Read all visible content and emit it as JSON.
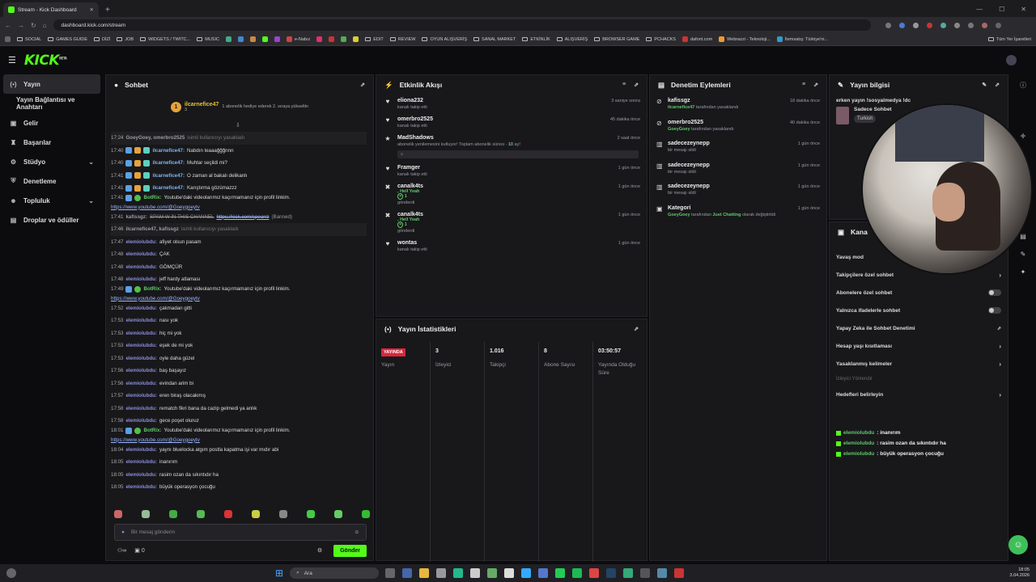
{
  "browser": {
    "tab_title": "Stream - Kick Dashboard",
    "url": "dashboard.kick.com/stream",
    "bookmarks": [
      "SOCIAL",
      "GAMES GUIDE",
      "DİZİ",
      "JOB",
      "WIDGETS / TWITC...",
      "MUSIC",
      "e-Nabız",
      "EDIT",
      "REVIEW",
      "OYUN ALIŞVERİŞ",
      "SANAL MARKET",
      "ETKİNLİK",
      "ALIŞVERİŞ",
      "BROWSER GAME",
      "PCHACKS",
      "dafont.com",
      "Webrazzi - Teknoloji...",
      "İtemsatış: Türkiye'ni..."
    ],
    "all_bookmarks": "Tüm Yer İşaretleri"
  },
  "sidebar": {
    "items": [
      {
        "label": "Yayın"
      },
      {
        "label": "Yayın Bağlantısı ve Anahtarı"
      },
      {
        "label": "Gelir"
      },
      {
        "label": "Başarılar"
      },
      {
        "label": "Stüdyo"
      },
      {
        "label": "Denetleme"
      },
      {
        "label": "Topluluk"
      },
      {
        "label": "Droplar ve ödüller"
      }
    ]
  },
  "chat": {
    "title": "Sohbet",
    "pinned_user": "ilcarnefice47",
    "pinned_count": "3",
    "pinned_text": "1 abonelik hediye ederek 2. sıraya yükseltin",
    "messages": [
      {
        "ts": "17:24",
        "user": "GoeyGoey, omerbro2525",
        "text": "isimli kullanıcıyı yasakladı",
        "sys": true
      },
      {
        "ts": "17:40",
        "user": "ilcarnefice47:",
        "text": "Nabdın leaaağğğnnn"
      },
      {
        "ts": "17:40",
        "user": "ilcarnefice47:",
        "text": "Muhtar seçildi mi?"
      },
      {
        "ts": "17:41",
        "user": "ilcarnefice47:",
        "text": "O zaman al bakalı delikanlı"
      },
      {
        "ts": "17:41",
        "user": "ilcarnefice47:",
        "text": "Karıştırma gözümazzz"
      },
      {
        "ts": "17:41",
        "user": "BotRix:",
        "text": "Youtube'daki videolarımız kaçırmamanız için profil linkim.",
        "link": "https://www.youtube.com/@Goeygoeytv"
      },
      {
        "ts": "17:41",
        "user": "kafissgz:",
        "text": "SPAM W IN THIS CHANNEL",
        "link2": "https://kick.com/spearrz",
        "extra": "(Banned)"
      },
      {
        "ts": "17:46",
        "user": "ilcarnefice47, kafissgz",
        "text": "isimli kullanıcıyı yasakladı",
        "sys": true
      },
      {
        "ts": "17:47",
        "user": "elemiolubdu:",
        "text": "afiyet olsun pasam"
      },
      {
        "ts": "17:48",
        "user": "elemiolubdu:",
        "text": "ÇAK"
      },
      {
        "ts": "17:48",
        "user": "elemiolubdu:",
        "text": "GÖMÇÜR"
      },
      {
        "ts": "17:48",
        "user": "elemiolubdu:",
        "text": "jeff hardy atlaması"
      },
      {
        "ts": "17:49",
        "user": "BotRix:",
        "text": "Youtube'daki videolarımız kaçırmamanız için profil linkim.",
        "link": "https://www.youtube.com/@Goeygoeytv"
      },
      {
        "ts": "17:52",
        "user": "elemiolubdu:",
        "text": "çakmadan gitti"
      },
      {
        "ts": "17:53",
        "user": "elemiolubdu:",
        "text": "nası yok"
      },
      {
        "ts": "17:53",
        "user": "elemiolubdu:",
        "text": "hiç mi yok"
      },
      {
        "ts": "17:53",
        "user": "elemiolubdu:",
        "text": "eşek de mi yok"
      },
      {
        "ts": "17:53",
        "user": "elemiolubdu:",
        "text": "oyle daha güzel"
      },
      {
        "ts": "17:56",
        "user": "elemiolubdu:",
        "text": "baş başayız"
      },
      {
        "ts": "17:56",
        "user": "elemiolubdu:",
        "text": "evindan arim bi"
      },
      {
        "ts": "17:57",
        "user": "elemiolubdu:",
        "text": "eren biraş olacakmış"
      },
      {
        "ts": "17:58",
        "user": "elemiolubdu:",
        "text": "rematch fikri bana da cazip gelmedi ya anlık"
      },
      {
        "ts": "17:58",
        "user": "elemiolubdu:",
        "text": "gece poşet oluruz"
      },
      {
        "ts": "18:01",
        "user": "BotRix:",
        "text": "Youtube'daki videolarımız kaçırmamanız için profil linkim.",
        "link": "https://www.youtube.com/@Goeygoeytv"
      },
      {
        "ts": "18:04",
        "user": "elemiolubdu:",
        "text": "yaynı bluelocka atgım postla kapatma işi var mıdır abi"
      },
      {
        "ts": "18:05",
        "user": "elemiolubdu:",
        "text": "inanırım"
      },
      {
        "ts": "18:05",
        "user": "elemiolubdu:",
        "text": "rasim ozan da sıkıntıdır ha"
      },
      {
        "ts": "18:05",
        "user": "elemiolubdu:",
        "text": "büyük operasyon çocuğu"
      }
    ],
    "input_placeholder": "Bir mesaj gönderin",
    "count_label": "0",
    "send_label": "Gönder"
  },
  "activity": {
    "title": "Etkinlik Akışı",
    "items": [
      {
        "name": "eliona232",
        "sub": "kanalı takip etti",
        "time": "3 saniye sonra",
        "icon": "♥"
      },
      {
        "name": "omerbro2525",
        "sub": "kanalı takip etti",
        "time": "45 dakika önce",
        "icon": "♥"
      },
      {
        "name": "MadShadows",
        "sub": "abonelik yenilemesini kutluyor! Toplam abonelik süresi - ",
        "hl": "10",
        "sub2": " ay!",
        "time": "2 saat önce",
        "icon": "★",
        "box": true
      },
      {
        "name": "Framger",
        "sub": "kanalı takip etti",
        "time": "1 gün önce",
        "icon": "♥"
      },
      {
        "name": "canalk4ts",
        "g": "Hell Yeah",
        "gc": "1",
        "sub": "gönderdi",
        "time": "1 gün önce",
        "icon": "✖"
      },
      {
        "name": "canalk4ts",
        "g": "Hell Yeah",
        "gc": "1",
        "sub": "gönderdi",
        "time": "1 gün önce",
        "icon": "✖"
      },
      {
        "name": "wontas",
        "sub": "kanalı takip etti",
        "time": "1 gün önce",
        "icon": "♥"
      }
    ]
  },
  "stats": {
    "title": "Yayın İstatistikleri",
    "live": "YAYINDA",
    "cells": [
      {
        "value": "",
        "label": "Yayın"
      },
      {
        "value": "3",
        "label": "İzleyici"
      },
      {
        "value": "1.016",
        "label": "Takipçi"
      },
      {
        "value": "8",
        "label": "Abone Sayısı"
      },
      {
        "value": "03:50:57",
        "label": "Yayında Olduğu Süre"
      }
    ]
  },
  "moderation": {
    "title": "Denetim Eylemleri",
    "items": [
      {
        "name": "kafissgz",
        "by": "ilcarnefice47",
        "sub": "tarafından yasaklandı",
        "time": "18 dakika önce",
        "icon": "⊘"
      },
      {
        "name": "omerbro2525",
        "by": "GoeyGoey",
        "sub": "tarafından yasaklandı",
        "time": "40 dakika önce",
        "icon": "⊘"
      },
      {
        "name": "sadecezeynepp",
        "sub": "bir mesajı sildi",
        "time": "1 gün önce",
        "icon": "🗑"
      },
      {
        "name": "sadecezeynepp",
        "sub": "bir mesajı sildi",
        "time": "1 gün önce",
        "icon": "🗑"
      },
      {
        "name": "sadecezeynepp",
        "sub": "bir mesajı sildi",
        "time": "1 gün önce",
        "icon": "🗑"
      },
      {
        "name": "Kategori",
        "by": "GoeyGoey",
        "sub": "tarafından",
        "cat": "Just Chatting",
        "sub2": "olarak değiştirildi",
        "time": "1 gün önce",
        "icon": "▣"
      }
    ]
  },
  "info": {
    "title": "Yayın bilgisi",
    "stream_title": "erken yayın !sosyalmedya !dc",
    "category": "Sadece Sohbet",
    "tag": "Turkish"
  },
  "settings": {
    "title": "Kana",
    "rows": [
      {
        "label": "Yavaş mod",
        "ctl": "none"
      },
      {
        "label": "Takipçilere özel sohbet",
        "ctl": "chev"
      },
      {
        "label": "Abonelere özel sohbet",
        "ctl": "toggle"
      },
      {
        "label": "Yalnızca ifadelerle sohbet",
        "ctl": "toggle"
      },
      {
        "label": "Yapay Zeka ile Sohbet Denetimi",
        "ctl": "ext"
      },
      {
        "label": "Hesap yaşı kısıtlaması",
        "ctl": "chev"
      },
      {
        "label": "Yasaklanmış kelimeler",
        "ctl": "chev"
      }
    ],
    "dim_label": "İzleyici Yönlendir",
    "targets_label": "Hedefleri belirleyin",
    "overlay": [
      {
        "user": "elemiolubdu",
        "msg": ": inanırım"
      },
      {
        "user": "elemiolubdu",
        "msg": ": rasim ozan da sıkıntıdır ha"
      },
      {
        "user": "elemiolubdu",
        "msg": ": büyük operasyon çocuğu"
      }
    ]
  },
  "taskbar": {
    "search": "Ara",
    "time": "18:05",
    "date": "3.04.2026"
  },
  "colors": {
    "accent": "#53fc18",
    "live": "#d8283c"
  }
}
